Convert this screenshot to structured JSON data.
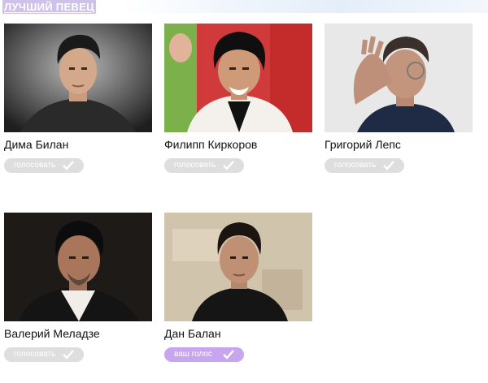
{
  "section": {
    "title": "ЛУЧШИЙ ПЕВЕЦ"
  },
  "candidates": [
    {
      "name": "Дима Билан",
      "button_label": "голосовать",
      "voted": false
    },
    {
      "name": "Филипп Киркоров",
      "button_label": "голосовать",
      "voted": false
    },
    {
      "name": "Григорий Лепс",
      "button_label": "голосовать",
      "voted": false
    },
    {
      "name": "Валерий Меладзе",
      "button_label": "голосовать",
      "voted": false
    },
    {
      "name": "Дан Балан",
      "button_label": "ваш голос",
      "voted": true
    }
  ],
  "colors": {
    "title_bg": "#cfc2ea",
    "button_default": "#dedede",
    "button_voted": "#c8a5ef",
    "button_text": "#ffffff"
  },
  "icons": {
    "vote_check": "check-icon"
  }
}
